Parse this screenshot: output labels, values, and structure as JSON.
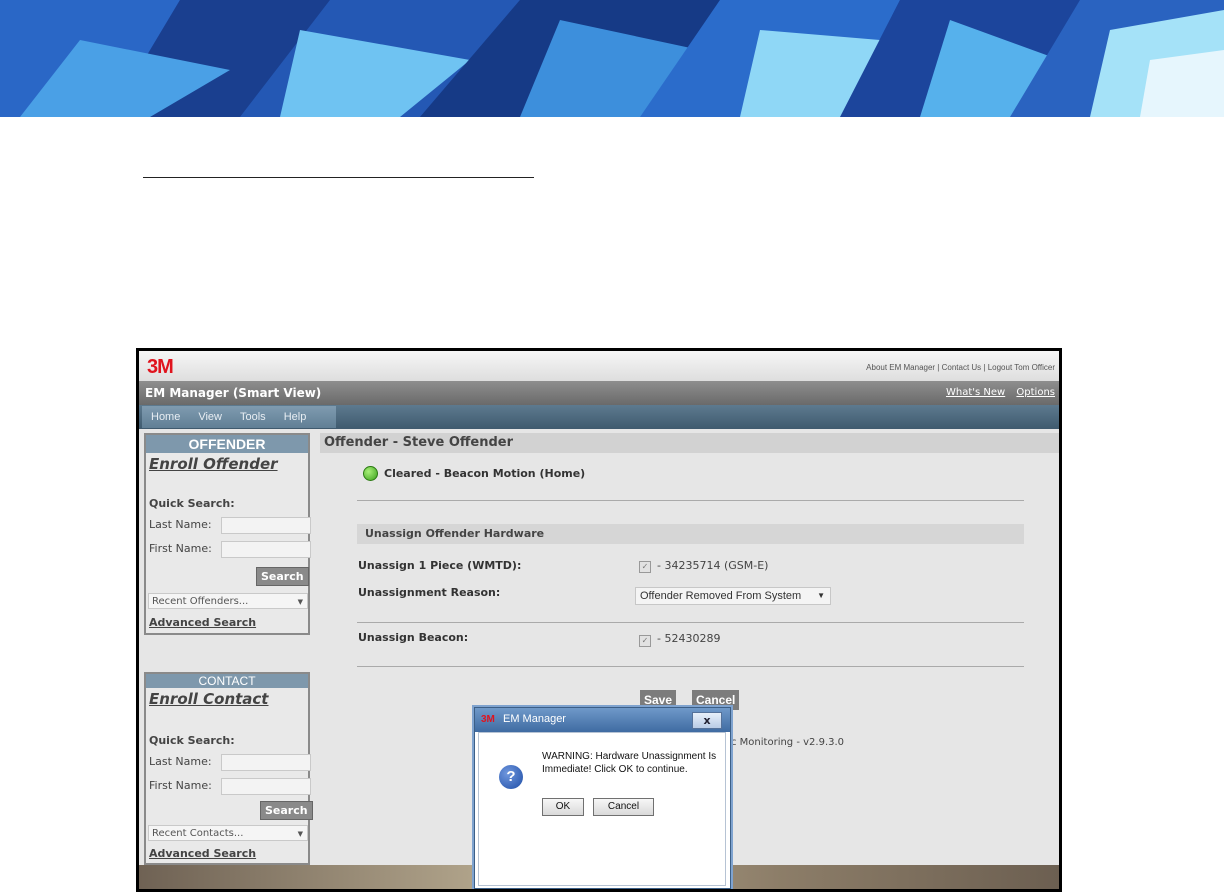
{
  "app": {
    "brand": "3M",
    "top_links": "About EM Manager | Contact Us | Logout Tom Officer",
    "title": "EM Manager (Smart View)",
    "whats_new": "What's New",
    "options": "Options",
    "menu": [
      "Home",
      "View",
      "Tools",
      "Help"
    ]
  },
  "offender_panel": {
    "heading": "OFFENDER",
    "enroll": "Enroll Offender",
    "quick_search": "Quick Search:",
    "last_name_label": "Last Name:",
    "first_name_label": "First Name:",
    "search": "Search",
    "recent": "Recent Offenders...",
    "advanced": "Advanced Search"
  },
  "contact_panel": {
    "heading": "CONTACT",
    "enroll": "Enroll Contact",
    "quick_search": "Quick Search:",
    "last_name_label": "Last Name:",
    "first_name_label": "First Name:",
    "search": "Search",
    "recent": "Recent Contacts...",
    "advanced": "Advanced Search"
  },
  "main": {
    "title": "Offender - Steve Offender",
    "status": "Cleared - Beacon Motion (Home)",
    "status_color": "#3aa01c",
    "section_title": "Unassign Offender Hardware",
    "piece_label": "Unassign 1 Piece (WMTD):",
    "piece_value": "- 34235714 (GSM-E)",
    "reason_label": "Unassignment Reason:",
    "reason_value": "Offender Removed From System",
    "beacon_label": "Unassign Beacon:",
    "beacon_value": "- 52430289",
    "save": "Save",
    "cancel": "Cancel",
    "version": "c Monitoring - v2.9.3.0"
  },
  "dialog": {
    "brand": "3M",
    "title": "EM Manager",
    "close": "x",
    "message": "WARNING: Hardware Unassignment Is Immediate! Click OK to continue.",
    "ok": "OK",
    "cancel": "Cancel",
    "icon": "question-icon"
  }
}
